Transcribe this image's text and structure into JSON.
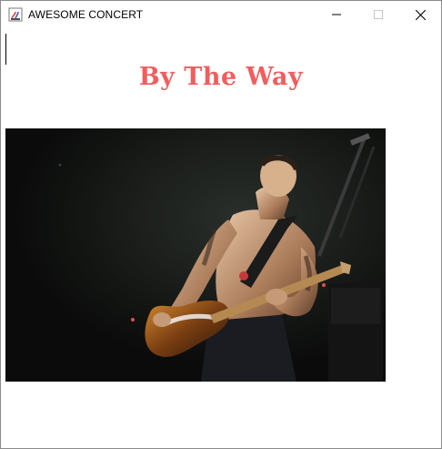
{
  "window": {
    "title": "AWESOME CONCERT",
    "controls": [
      "minimize",
      "maximize",
      "close"
    ]
  },
  "main": {
    "song_title": "By The Way",
    "song_title_color": "#f25d5d",
    "photo": {
      "description_icon": "concert-photo",
      "subject": "guitarist performing on stage"
    }
  }
}
